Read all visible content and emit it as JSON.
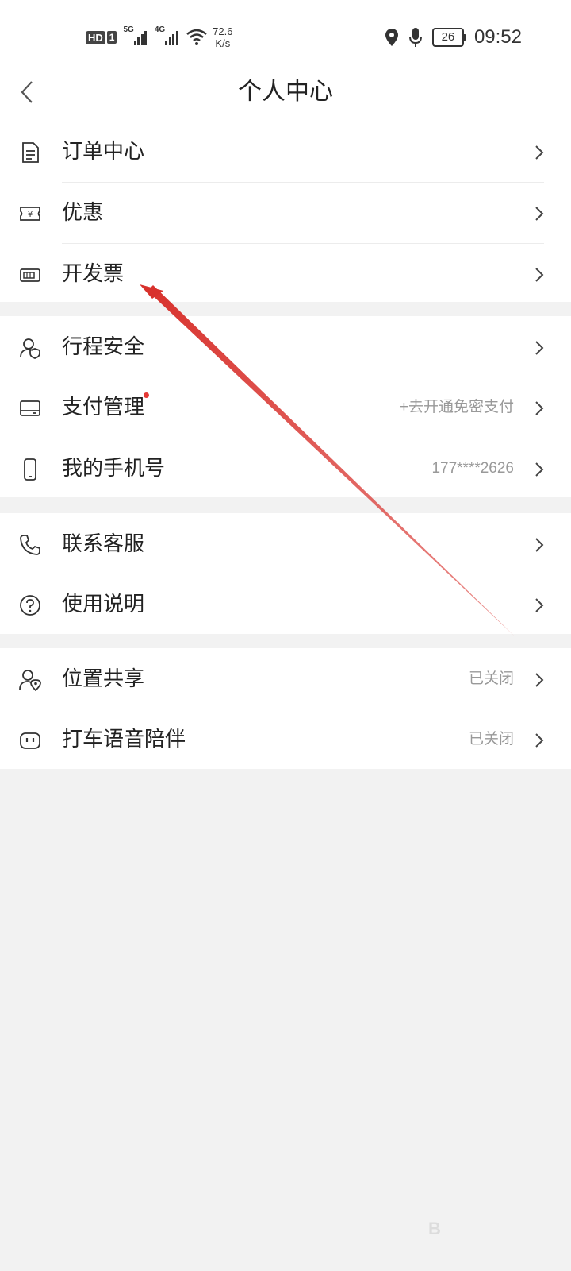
{
  "status_bar": {
    "hd": "HD",
    "sim": "1",
    "net1": "5G",
    "net2": "4G",
    "speed_value": "72.6",
    "speed_unit": "K/s",
    "battery": "26",
    "time": "09:52"
  },
  "header": {
    "title": "个人中心"
  },
  "sections": [
    {
      "items": [
        {
          "label": "订单中心",
          "value": "",
          "icon": "document-icon"
        },
        {
          "label": "优惠",
          "value": "",
          "icon": "coupon-icon"
        },
        {
          "label": "开发票",
          "value": "",
          "icon": "invoice-icon"
        }
      ]
    },
    {
      "items": [
        {
          "label": "行程安全",
          "value": "",
          "icon": "trip-safety-icon"
        },
        {
          "label": "支付管理",
          "value": "+去开通免密支付",
          "icon": "card-icon",
          "badge": "red-dot"
        },
        {
          "label": "我的手机号",
          "value": "177****2626",
          "icon": "phone-icon"
        }
      ]
    },
    {
      "items": [
        {
          "label": "联系客服",
          "value": "",
          "icon": "call-icon"
        },
        {
          "label": "使用说明",
          "value": "",
          "icon": "help-icon"
        }
      ]
    },
    {
      "items": [
        {
          "label": "位置共享",
          "value": "已关闭",
          "icon": "location-share-icon"
        },
        {
          "label": "打车语音陪伴",
          "value": "已关闭",
          "icon": "voice-companion-icon"
        }
      ]
    }
  ],
  "watermark": "B",
  "colors": {
    "background": "#f2f2f2",
    "card": "#ffffff",
    "text": "#222222",
    "secondary_text": "#999999",
    "badge": "#e53935",
    "annotation_arrow": "#d8312c"
  }
}
